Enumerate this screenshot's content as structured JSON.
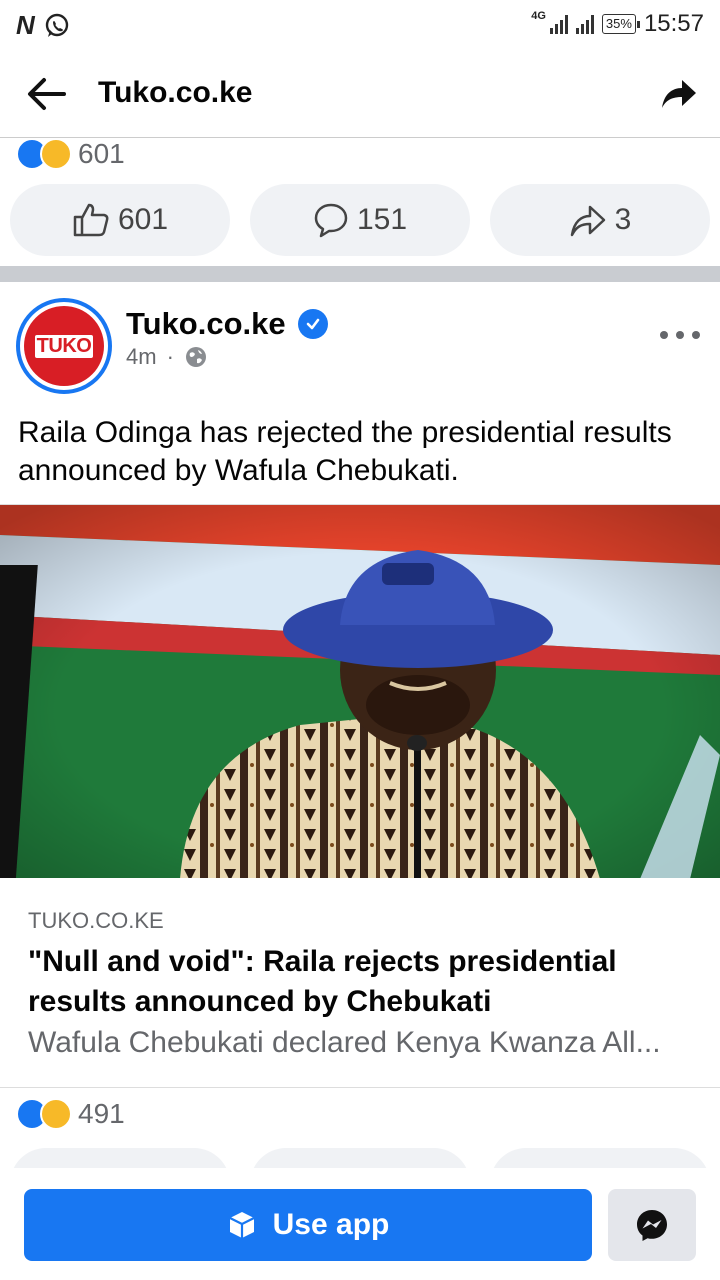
{
  "status_bar": {
    "left_icons": [
      "netflix-n-icon",
      "whatsapp-icon"
    ],
    "network": "4G",
    "battery": "35%",
    "time": "15:57"
  },
  "app_bar": {
    "title": "Tuko.co.ke"
  },
  "previous_post": {
    "reaction_count": "601",
    "like_count": "601",
    "comment_count": "151",
    "share_count": "3"
  },
  "post": {
    "page_name": "Tuko.co.ke",
    "avatar_text": "TUKO",
    "time_ago": "4m",
    "text": "Raila Odinga has rejected the presidential results announced by Wafula Chebukati.",
    "link": {
      "domain": "TUKO.CO.KE",
      "title": "\"Null and void\": Raila rejects presidential results announced by Chebukati",
      "description": "Wafula Chebukati declared Kenya Kwanza All..."
    },
    "reaction_count": "491"
  },
  "bottom_bar": {
    "use_app_label": "Use app"
  },
  "colors": {
    "facebook_blue": "#1877f2",
    "tuko_red": "#d81e25",
    "muted_text": "#65676b"
  }
}
